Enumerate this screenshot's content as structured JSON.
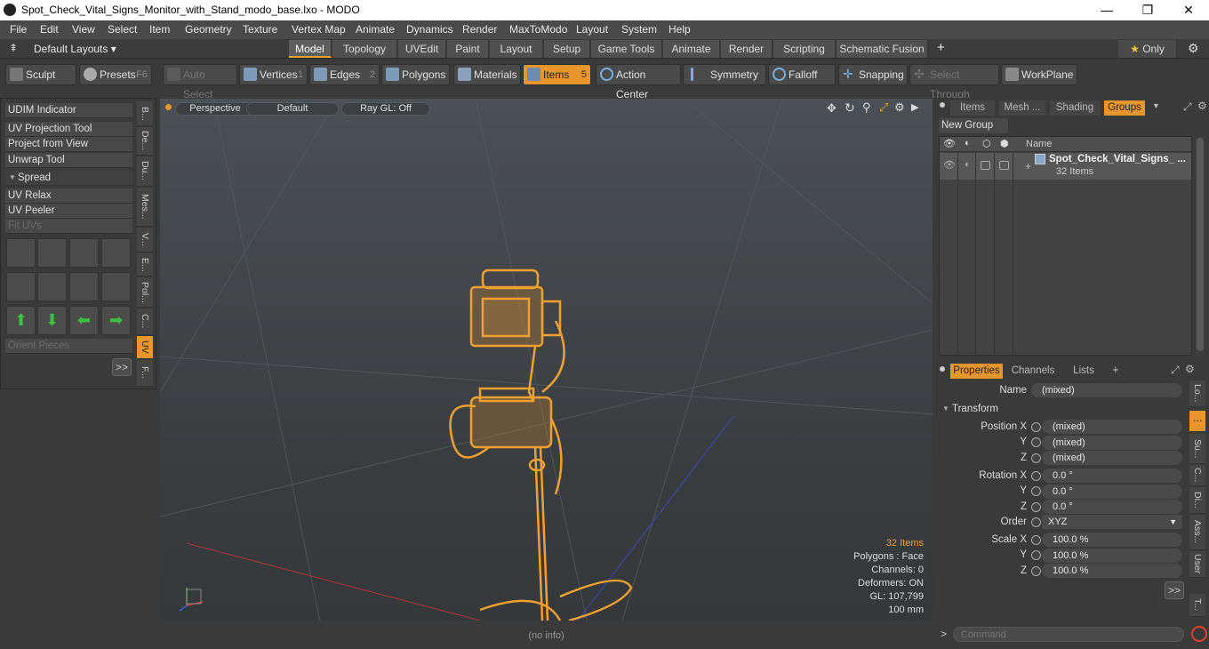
{
  "window": {
    "title": "Spot_Check_Vital_Signs_Monitor_with_Stand_modo_base.lxo - MODO",
    "min": "—",
    "max": "❐",
    "close": "✕"
  },
  "menu": [
    "File",
    "Edit",
    "View",
    "Select",
    "Item",
    "Geometry",
    "Texture",
    "Vertex Map",
    "Animate",
    "Dynamics",
    "Render",
    "MaxToModo",
    "Layout",
    "System",
    "Help"
  ],
  "layout": {
    "switcher": "Default Layouts ▾",
    "tabs": [
      "Model",
      "Topology",
      "UVEdit",
      "Paint",
      "Layout",
      "Setup",
      "Game Tools",
      "Animate",
      "Render",
      "Scripting",
      "Schematic Fusion"
    ],
    "active": "Model",
    "add": "+",
    "only": "Only"
  },
  "toolbar": {
    "sculpt": "Sculpt",
    "presets": "Presets",
    "presets_key": "F6",
    "auto_select": "Auto Select",
    "vertices": "Vertices",
    "vertices_num": "1",
    "edges": "Edges",
    "edges_num": "2",
    "polygons": "Polygons",
    "materials": "Materials",
    "items": "Items",
    "items_num": "5",
    "action_center": "Action Center",
    "symmetry": "Symmetry",
    "falloff": "Falloff",
    "snapping": "Snapping",
    "select_through": "Select Through",
    "workplane": "WorkPlane"
  },
  "left_panel": {
    "uvtools": [
      "UDIM Indicator",
      "UV Projection Tool",
      "Project from View",
      "Unwrap Tool"
    ],
    "spread": "Spread",
    "relax": [
      "UV Relax",
      "UV Peeler",
      "Fit UVs"
    ],
    "orient": "Orient Pieces",
    "more": ">>",
    "vtabs": [
      "B...",
      "De...",
      "Du...",
      "Mes...",
      "V...",
      "E...",
      "Pol...",
      "C...",
      "UV",
      "F..."
    ]
  },
  "viewport": {
    "view": "Perspective",
    "shading": "Default",
    "raygl": "Ray GL: Off",
    "info": {
      "items": "32 Items",
      "polygons": "Polygons : Face",
      "channels": "Channels: 0",
      "deformers": "Deformers: ON",
      "gl": "GL: 107,799",
      "scale": "100 mm"
    }
  },
  "items_panel": {
    "tabs": [
      "Items",
      "Mesh ...",
      "Shading",
      "Groups"
    ],
    "active": "Groups",
    "new_group": "New Group",
    "col_name": "Name",
    "group_name": "Spot_Check_Vital_Signs_ ...",
    "group_count": "32 Items"
  },
  "props": {
    "tabs": [
      "Properties",
      "Channels",
      "Lists"
    ],
    "name_label": "Name",
    "name_value": "(mixed)",
    "transform": "Transform",
    "rows": [
      {
        "label": "Position X",
        "value": "(mixed)"
      },
      {
        "label": "Y",
        "value": "(mixed)"
      },
      {
        "label": "Z",
        "value": "(mixed)"
      },
      {
        "label": "Rotation X",
        "value": "0.0 °"
      },
      {
        "label": "Y",
        "value": "0.0 °"
      },
      {
        "label": "Z",
        "value": "0.0 °"
      },
      {
        "label": "Order",
        "value": "XYZ"
      },
      {
        "label": "Scale X",
        "value": "100.0 %"
      },
      {
        "label": "Y",
        "value": "100.0 %"
      },
      {
        "label": "Z",
        "value": "100.0 %"
      }
    ],
    "vtabs": [
      "Lo...",
      "Su...",
      "C...",
      "Di...",
      "Ass...",
      "User",
      "T..."
    ],
    "more": ">>"
  },
  "status": {
    "info": "(no info)",
    "command_placeholder": "Command",
    "prompt": ">"
  }
}
